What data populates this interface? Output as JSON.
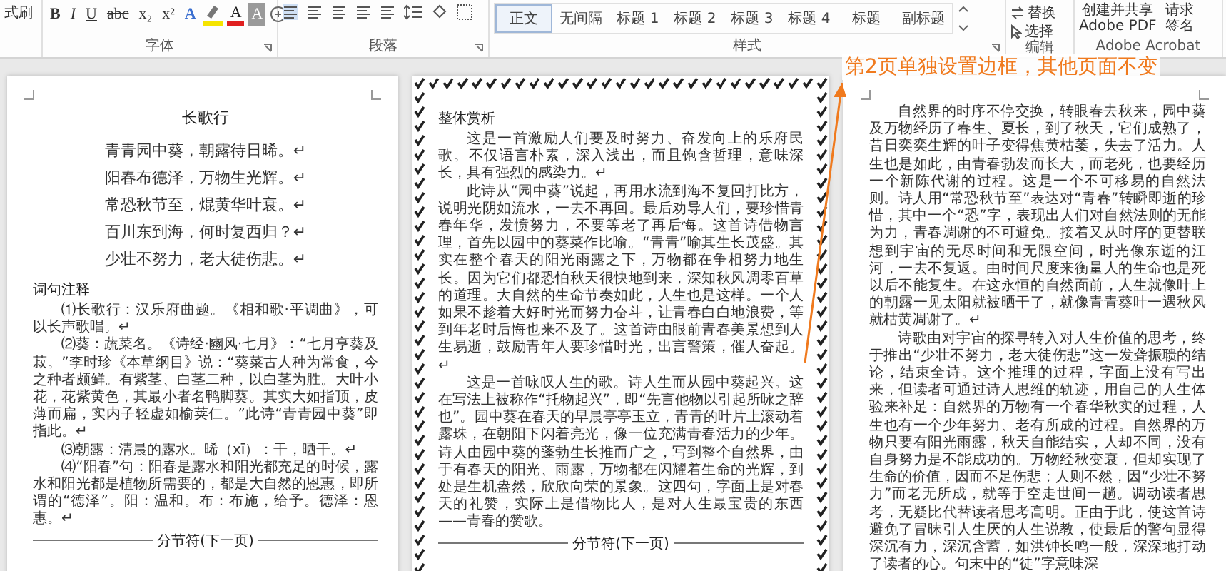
{
  "ribbon": {
    "clipboard_label": "式刷",
    "font_buttons": [
      {
        "kind": "bold",
        "label": "B"
      },
      {
        "kind": "italic",
        "label": "I"
      },
      {
        "kind": "underline",
        "label": "U"
      },
      {
        "kind": "strike",
        "label": "abc"
      },
      {
        "kind": "sub",
        "label": "x₂"
      },
      {
        "kind": "sup",
        "label": "x²"
      },
      {
        "kind": "effects",
        "label": "A"
      },
      {
        "kind": "highlight"
      },
      {
        "kind": "font-color",
        "label": "A"
      },
      {
        "kind": "shading",
        "label": "A"
      }
    ],
    "groups": [
      "字体",
      "段落",
      "样式",
      "编辑",
      "Adobe Acrobat"
    ],
    "styles": [
      {
        "label": "正文",
        "selected": true
      },
      {
        "label": "无间隔",
        "selected": false
      },
      {
        "label": "标题 1",
        "selected": false
      },
      {
        "label": "标题 2",
        "selected": false
      },
      {
        "label": "标题 3",
        "selected": false
      },
      {
        "label": "标题 4",
        "selected": false
      },
      {
        "label": "标题",
        "selected": false
      },
      {
        "label": "副标题",
        "selected": false
      }
    ],
    "editing": [
      "替换",
      "选择"
    ],
    "acrobat": [
      "创建并共享\nAdobe PDF",
      "请求签名"
    ]
  },
  "annotation": "第2页单独设置边框，其他页面不变",
  "pages": [
    {
      "bordered": false,
      "blocks": [
        {
          "kind": "title",
          "text": "长歌行"
        },
        {
          "kind": "verse",
          "text": "青青园中葵，朝露待日晞。↵"
        },
        {
          "kind": "verse",
          "text": "阳春布德泽，万物生光辉。↵"
        },
        {
          "kind": "verse",
          "text": "常恐秋节至，焜黄华叶衰。↵"
        },
        {
          "kind": "verse",
          "text": "百川东到海，何时复西归？↵"
        },
        {
          "kind": "verse",
          "text": "少壮不努力，老大徒伤悲。↵"
        },
        {
          "kind": "heading",
          "text": "词句注释"
        },
        {
          "kind": "para",
          "text": "⑴长歌行：汉乐府曲题。《相和歌·平调曲》，可以长声歌唱。↵"
        },
        {
          "kind": "para",
          "text": "⑵葵：蔬菜名。《诗经·豳风·七月》：“七月亨葵及菽。”李时珍《本草纲目》说：“葵菜古人种为常食，今之种者颇鲜。有紫茎、白茎二种，以白茎为胜。大叶小花，花紫黄色，其最小者名鸭脚葵。其实大如指顶，皮薄而扁，实内子轻虚如榆荚仁。”此诗“青青园中葵”即指此。↵"
        },
        {
          "kind": "para",
          "text": "⑶朝露：清晨的露水。晞（xī）：干，晒干。↵"
        },
        {
          "kind": "para",
          "text": "⑷“阳春”句：阳春是露水和阳光都充足的时候，露水和阳光都是植物所需要的，都是大自然的恩惠，即所谓的“德泽”。阳：温和。布：布施，给予。德泽：恩惠。↵"
        },
        {
          "kind": "break",
          "text": "分节符(下一页)"
        }
      ]
    },
    {
      "bordered": true,
      "blocks": [
        {
          "kind": "heading",
          "text": "整体赏析"
        },
        {
          "kind": "para",
          "text": "这是一首激励人们要及时努力、奋发向上的乐府民歌。不仅语言朴素，深入浅出，而且饱含哲理，意味深长，具有强烈的感染力。↵"
        },
        {
          "kind": "para",
          "text": "此诗从“园中葵”说起，再用水流到海不复回打比方，说明光阴如流水，一去不再回。最后劝导人们，要珍惜青春年华，发愤努力，不要等老了再后悔。这首诗借物言理，首先以园中的葵菜作比喻。“青青”喻其生长茂盛。其实在整个春天的阳光雨露之下，万物都在争相努力地生长。因为它们都恐怕秋天很快地到来，深知秋风凋零百草的道理。大自然的生命节奏如此，人生也是这样。一个人如果不趁着大好时光而努力奋斗，让青春白白地浪费，等到年老时后悔也来不及了。这首诗由眼前青春美景想到人生易逝，鼓励青年人要珍惜时光，出言警策，催人奋起。↵"
        },
        {
          "kind": "para",
          "text": "这是一首咏叹人生的歌。诗人生而从园中葵起兴。这在写法上被称作“托物起兴”，即“先言他物以引起所咏之辞也”。园中葵在春天的早晨亭亭玉立，青青的叶片上滚动着露珠，在朝阳下闪着亮光，像一位充满青春活力的少年。诗人由园中葵的蓬勃生长推而广之，写到整个自然界，由于有春天的阳光、雨露，万物都在闪耀着生命的光辉，到处是生机盎然，欣欣向荣的景象。这四句，字面上是对春天的礼赞，实际上是借物比人，是对人生最宝贵的东西——青春的赞歌。"
        },
        {
          "kind": "break",
          "text": "分节符(下一页)"
        }
      ]
    },
    {
      "bordered": false,
      "blocks": [
        {
          "kind": "para",
          "text": "自然界的时序不停交换，转眼春去秋来，园中葵及万物经历了春生、夏长，到了秋天，它们成熟了，昔日奕奕生辉的叶子变得焦黄枯萎，失去了活力。人生也是如此，由青春勃发而长大，而老死，也要经历一个新陈代谢的过程。这是一个不可移易的自然法则。诗人用“常恐秋节至”表达对“青春”转瞬即逝的珍惜，其中一个“恐”字，表现出人们对自然法则的无能为力，青春凋谢的不可避免。接着又从时序的更替联想到宇宙的无尽时间和无限空间，时光像东逝的江河，一去不复返。由时间尺度来衡量人的生命也是死以后不能复生。在这永恒的自然面前，人生就像叶上的朝露一见太阳就被晒干了，就像青青葵叶一遇秋风就枯黄凋谢了。↵"
        },
        {
          "kind": "para",
          "text": "诗歌由对宇宙的探寻转入对人生价值的思考，终于推出“少壮不努力，老大徒伤悲”这一发聋振聩的结论，结束全诗。这个推理的过程，字面上没有写出来，但读者可通过诗人思维的轨迹，用自己的人生体验来补足：自然界的万物有一个春华秋实的过程，人生也有一个少年努力、老有所成的过程。自然界的万物只要有阳光雨露，秋天自能结实，人却不同，没有自身努力是不能成功的。万物经秋变衰，但却实现了生命的价值，因而不足伤悲；人则不然，因“少壮不努力”而老无所成，就等于空走世间一趟。调动读者思考，无疑比代替读者思考高明。正由于此，使这首诗避免了冒昧引人生厌的人生说教，使最后的警句显得深沉有力，深沉含蓄，如洪钟长鸣一般，深深地打动了读者的心。句末中的“徒”字意味深"
        }
      ]
    }
  ]
}
